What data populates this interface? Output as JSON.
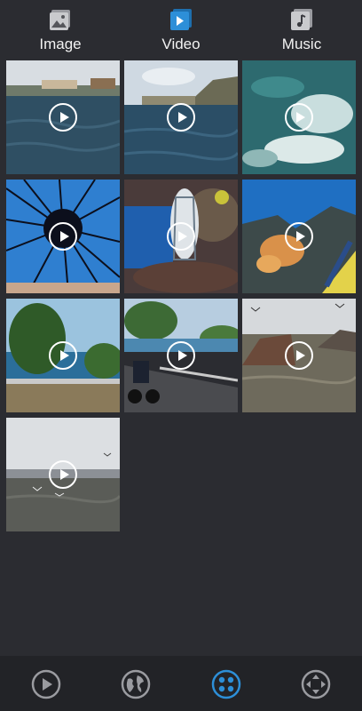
{
  "tabs": [
    {
      "label": "Image",
      "icon": "image-icon",
      "active": false
    },
    {
      "label": "Video",
      "icon": "video-icon",
      "active": true
    },
    {
      "label": "Music",
      "icon": "music-icon",
      "active": false
    }
  ],
  "colors": {
    "accent": "#2d8fd8",
    "background": "#2b2c31",
    "bar": "#222327",
    "icon_inactive": "#9a9ba0"
  },
  "videos": [
    {
      "scene": "coastal-village-sea"
    },
    {
      "scene": "harbor-hillside-sea"
    },
    {
      "scene": "underwater-surface-foam"
    },
    {
      "scene": "sea-urchin"
    },
    {
      "scene": "striped-fish-coral"
    },
    {
      "scene": "coral-reef-blue-water"
    },
    {
      "scene": "tree-by-sea-road"
    },
    {
      "scene": "motorbike-coastal-road"
    },
    {
      "scene": "rocks-sea-birds"
    },
    {
      "scene": "sea-gulls-shore"
    }
  ],
  "bottom_nav": [
    {
      "icon": "play-circle-icon",
      "active": false
    },
    {
      "icon": "globe-icon",
      "active": false
    },
    {
      "icon": "grid-dots-icon",
      "active": true
    },
    {
      "icon": "expand-arrows-icon",
      "active": false
    }
  ]
}
